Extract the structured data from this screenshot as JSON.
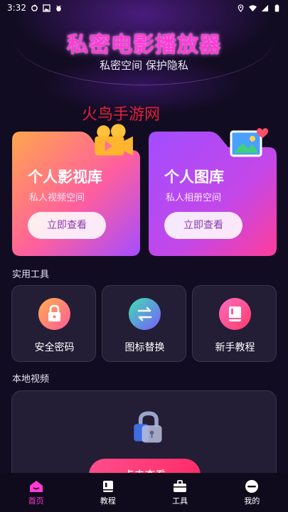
{
  "status_bar": {
    "time": "3:32"
  },
  "header": {
    "title": "私密电影播放器",
    "subtitle": "私密空间 保护隐私"
  },
  "watermark": "火鸟手游网",
  "cards": [
    {
      "title": "个人影视库",
      "subtitle": "私人视频空间",
      "button": "立即查看"
    },
    {
      "title": "个人图库",
      "subtitle": "私人相册空间",
      "button": "立即查看"
    }
  ],
  "tools_section": {
    "label": "实用工具"
  },
  "tools": [
    {
      "label": "安全密码",
      "icon": "lock-icon"
    },
    {
      "label": "图标替换",
      "icon": "swap-icon"
    },
    {
      "label": "新手教程",
      "icon": "book-icon"
    }
  ],
  "local_video": {
    "label": "本地视频",
    "button": "点击查看"
  },
  "tabbar": [
    {
      "label": "首页",
      "icon": "home-icon",
      "active": true
    },
    {
      "label": "教程",
      "icon": "book-icon",
      "active": false
    },
    {
      "label": "工具",
      "icon": "toolbox-icon",
      "active": false
    },
    {
      "label": "我的",
      "icon": "user-icon",
      "active": false
    }
  ],
  "colors": {
    "accent": "#ff3bd6",
    "background": "#120c22",
    "panel": "#231d35"
  }
}
